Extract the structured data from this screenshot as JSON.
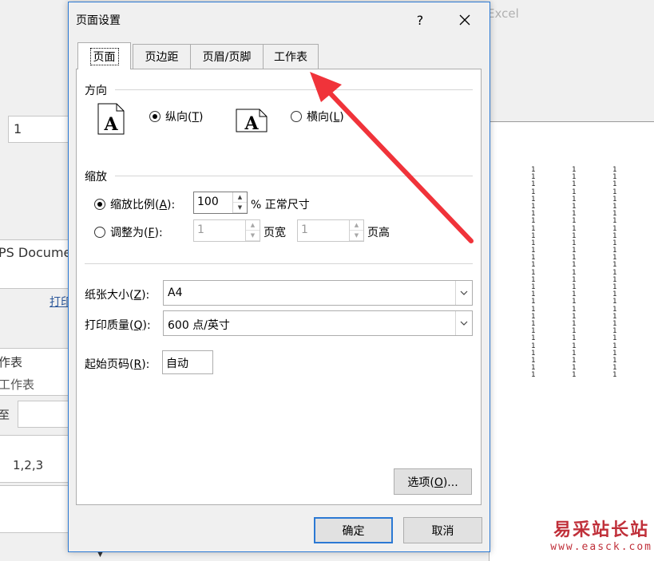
{
  "background": {
    "app_title_fragment": "Excel",
    "copies_value": "1",
    "printer_name_fragment": "PS Docume",
    "printer_link_fragment": "打印",
    "print_what_fragment_1": "作表",
    "print_what_fragment_2": "工作表",
    "pages_label_fragment": "至",
    "collate_value": "1,2,3",
    "preview_cell_value": "1"
  },
  "watermark": {
    "text": "易采站长站",
    "url": "www.easck.com"
  },
  "dialog": {
    "title": "页面设置",
    "help_label": "?",
    "tabs": [
      {
        "label": "页面"
      },
      {
        "label": "页边距"
      },
      {
        "label": "页眉/页脚"
      },
      {
        "label": "工作表"
      }
    ],
    "orientation": {
      "group_label": "方向",
      "portrait_label": "纵向(",
      "portrait_key": "T",
      "landscape_label": "横向(",
      "landscape_key": "L",
      "close_paren": ")",
      "selected": "portrait",
      "icon_letter": "A"
    },
    "scaling": {
      "group_label": "缩放",
      "adjust_label": "缩放比例(",
      "adjust_key": "A",
      "adjust_suffix": "):",
      "adjust_value": "100",
      "adjust_unit": "% 正常尺寸",
      "fit_label": "调整为(",
      "fit_key": "F",
      "fit_suffix": "):",
      "fit_wide_value": "1",
      "fit_wide_unit": "页宽",
      "fit_tall_value": "1",
      "fit_tall_unit": "页高",
      "selected": "adjust"
    },
    "paper_size": {
      "label": "纸张大小(",
      "key": "Z",
      "suffix": "):",
      "value": "A4"
    },
    "print_quality": {
      "label": "打印质量(",
      "key": "Q",
      "suffix": "):",
      "value": "600 点/英寸"
    },
    "first_page_number": {
      "label": "起始页码(",
      "key": "R",
      "suffix": "):",
      "value": "自动"
    },
    "options_button": {
      "label": "选项(",
      "key": "O",
      "suffix": ")..."
    },
    "ok_label": "确定",
    "cancel_label": "取消"
  },
  "colors": {
    "accent": "#2b79d4",
    "annotation_arrow": "#f0333a"
  }
}
